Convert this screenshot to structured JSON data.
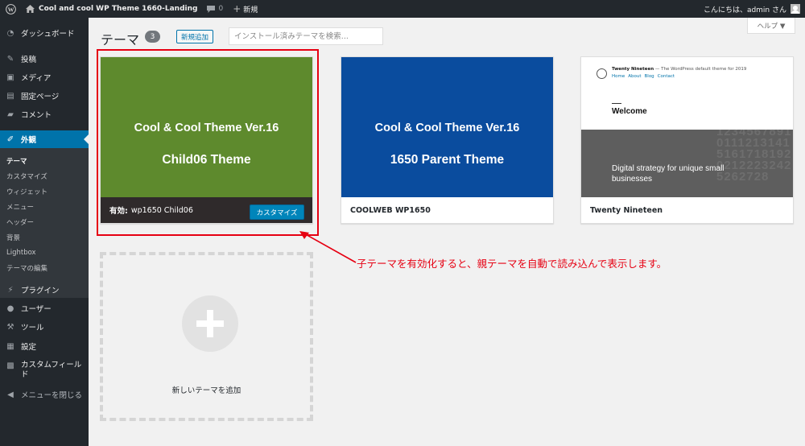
{
  "admin_bar": {
    "site_name": "Cool and cool WP Theme 1660-Landing",
    "comments_count": "0",
    "new_label": "新規",
    "greeting": "こんにちは、admin さん"
  },
  "sidebar": {
    "dashboard": "ダッシュボード",
    "posts": "投稿",
    "media": "メディア",
    "pages": "固定ページ",
    "comments": "コメント",
    "appearance": "外観",
    "appearance_sub": [
      "テーマ",
      "カスタマイズ",
      "ウィジェット",
      "メニュー",
      "ヘッダー",
      "背景",
      "Lightbox",
      "テーマの編集"
    ],
    "plugins": "プラグイン",
    "users": "ユーザー",
    "tools": "ツール",
    "settings": "設定",
    "custom_fields": "カスタムフィールド",
    "collapse": "メニューを閉じる"
  },
  "header": {
    "title": "テーマ",
    "count": "3",
    "add_new": "新規追加",
    "search_placeholder": "インストール済みテーマを検索...",
    "help": "ヘルプ ▼"
  },
  "themes": [
    {
      "line1": "Cool & Cool Theme Ver.16",
      "line2": "Child06 Theme",
      "active_label": "有効:",
      "name": "wp1650 Child06",
      "customize": "カスタマイズ",
      "bg": "#5e8a2d"
    },
    {
      "line1": "Cool & Cool Theme Ver.16",
      "line2": "1650 Parent Theme",
      "name": "COOLWEB WP1650",
      "bg": "#0a4c9e"
    },
    {
      "name": "Twenty Nineteen",
      "shot": {
        "site_title": "Twenty Nineteen",
        "tagline": " — The WordPress default theme for 2019",
        "nav": [
          "Home",
          "About",
          "Blog",
          "Contact"
        ],
        "welcome": "Welcome",
        "strategy": "Digital strategy for unique small businesses",
        "grid_digits": "12345678910111213141516171819202122232425262728"
      }
    }
  ],
  "add_new_theme": "新しいテーマを追加",
  "annotation": "子テーマを有効化すると、親テーマを自動で読み込んで表示します。",
  "colors": {
    "accent": "#0073aa",
    "annotation": "#e60012"
  }
}
